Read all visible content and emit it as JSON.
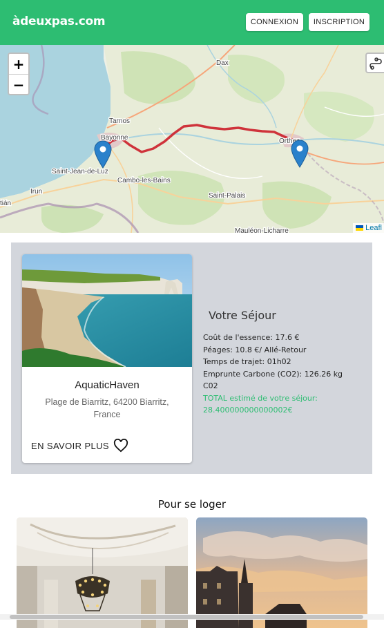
{
  "header": {
    "logo": "àdeuxpas.com",
    "login_label": "CONNEXION",
    "register_label": "INSCRIPTION",
    "color": "#2dbd72"
  },
  "map": {
    "zoom_in": "+",
    "zoom_out": "−",
    "place_labels": [
      "Dax",
      "Tarnos",
      "Bayonne",
      "Saint-Jean-de-Luz",
      "Irun",
      "Cambo-les-Bains",
      "Saint-Palais",
      "Mauléon-Licharre",
      "Orthez",
      "tián"
    ],
    "attribution": "Leafl",
    "route_color": "#cc1f2a",
    "marker_color": "#2a81cb"
  },
  "stay_card": {
    "title": "AquaticHaven",
    "address": "Plage de Biarritz, 64200 Biarritz, France",
    "more_label": "EN SAVOIR PLUS",
    "favorite_icon": "heart-icon"
  },
  "summary": {
    "title": "Votre Séjour",
    "fuel": "Coût de l'essence: 17.6 €",
    "tolls": "Péages: 10.8 €/ Allé-Retour",
    "travel_time": "Temps de trajet: 01h02",
    "carbon": "Emprunte Carbone (CO2): 126.26 kg C02",
    "total": "TOTAL estimé de votre séjour: 28.400000000000002€",
    "total_color": "#2dbd72"
  },
  "lodging": {
    "title": "Pour se loger"
  }
}
